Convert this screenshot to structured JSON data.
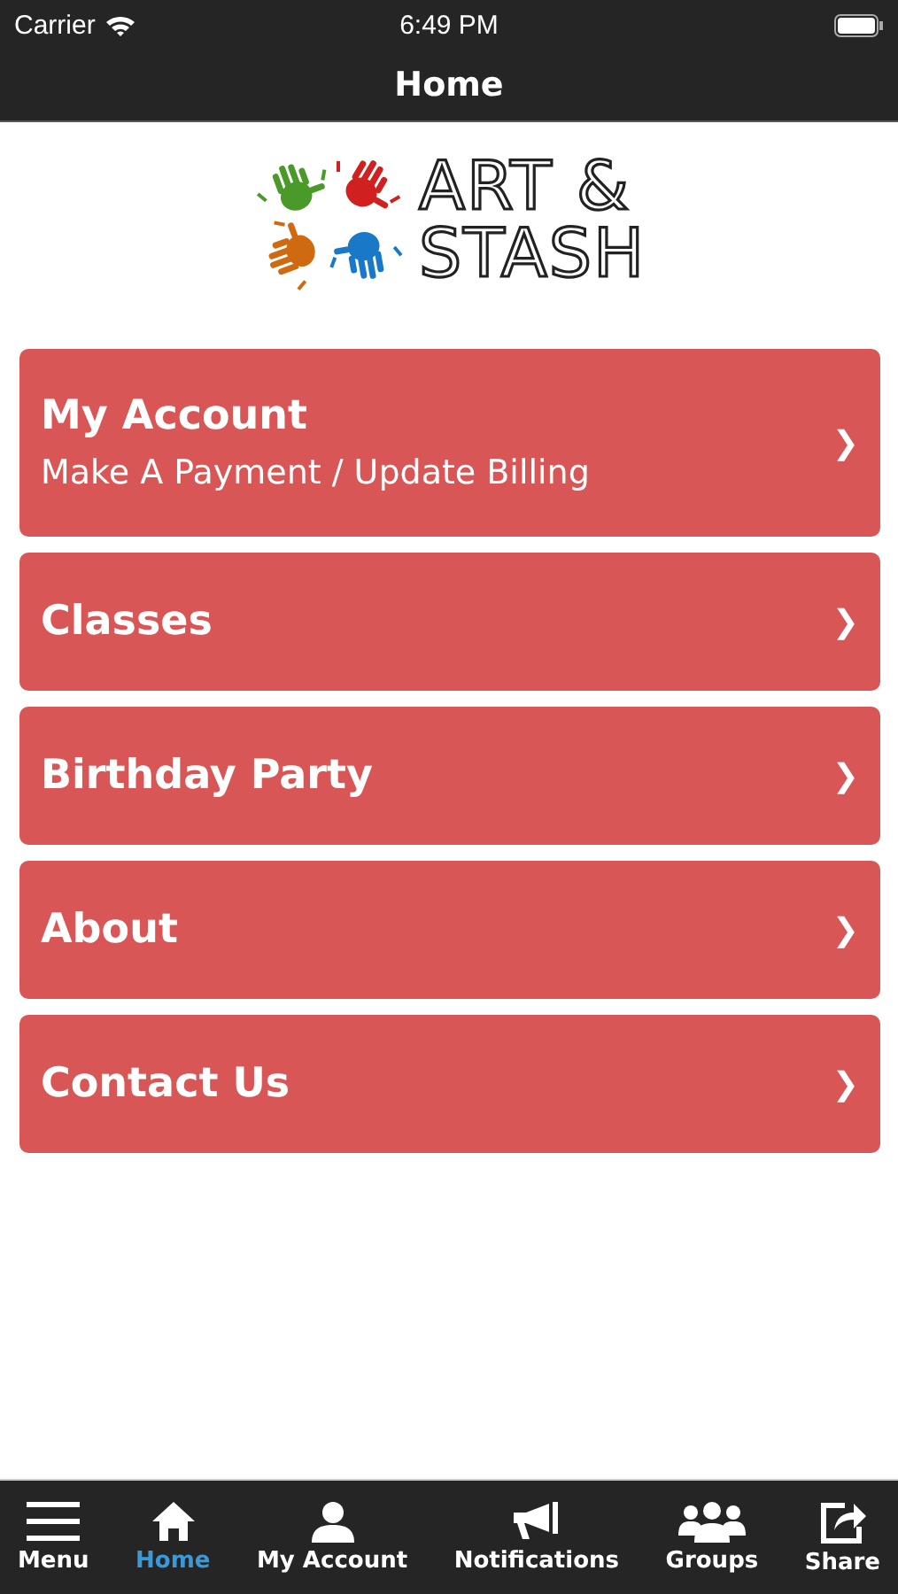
{
  "status_bar": {
    "carrier": "Carrier",
    "time": "6:49 PM"
  },
  "nav_bar": {
    "title": "Home"
  },
  "logo": {
    "lines": [
      "ART &",
      "STASH"
    ]
  },
  "menu_items": [
    {
      "title": "My Account",
      "subtitle": "Make A Payment / Update Billing",
      "chevron": "❯"
    },
    {
      "title": "Classes",
      "chevron": "❯"
    },
    {
      "title": "Birthday Party",
      "chevron": "❯"
    },
    {
      "title": "About",
      "chevron": "❯"
    },
    {
      "title": "Contact Us",
      "chevron": "❯"
    }
  ],
  "tab_bar": [
    {
      "label": "Menu",
      "selected": false
    },
    {
      "label": "Home",
      "selected": true
    },
    {
      "label": "My Account",
      "selected": false
    },
    {
      "label": "Notifications",
      "selected": false
    },
    {
      "label": "Groups",
      "selected": false
    },
    {
      "label": "Share",
      "selected": false
    }
  ]
}
